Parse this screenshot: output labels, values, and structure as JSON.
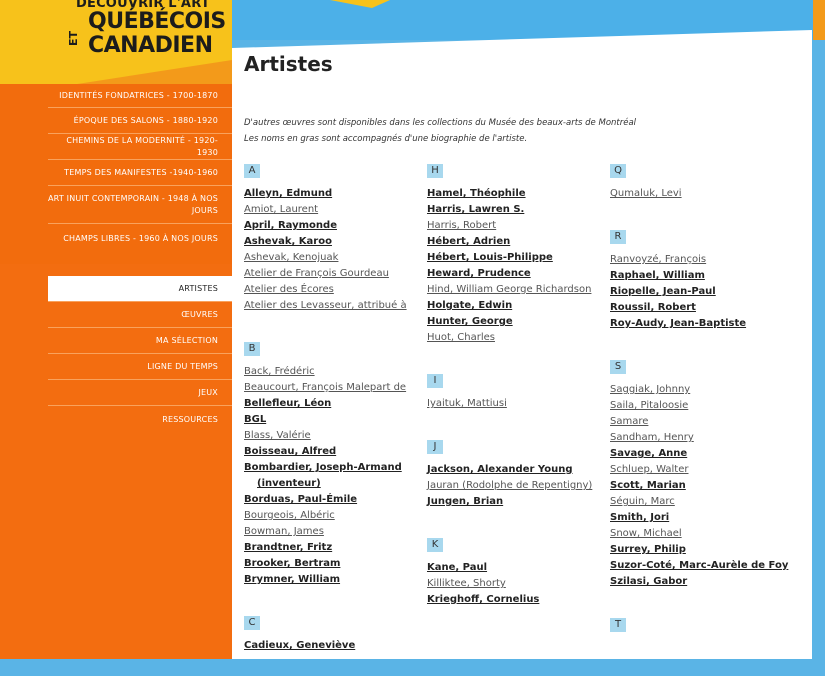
{
  "logo": {
    "line1": "DÉCOUVRIR L'ART",
    "line2": "QUÉBÉCOIS",
    "line3": "CANADIEN",
    "et": "ET"
  },
  "nav": {
    "main": [
      "IDENTITÉS FONDATRICES - 1700-1870",
      "ÉPOQUE DES SALONS - 1880-1920",
      "CHEMINS DE LA MODERNITÉ - 1920-1930",
      "TEMPS DES MANIFESTES -1940-1960",
      "ART INUIT CONTEMPORAIN - 1948 À NOS JOURS",
      "CHAMPS LIBRES - 1960 À NOS JOURS"
    ],
    "sub": [
      "ARTISTES",
      "ŒUVRES",
      "MA SÉLECTION",
      "LIGNE DU TEMPS",
      "JEUX",
      "RESSOURCES"
    ]
  },
  "page": {
    "title": "Artistes",
    "intro1": "D'autres œuvres sont disponibles dans les collections du Musée des beaux-arts de Montréal",
    "intro2": "Les noms en gras sont accompagnés d'une biographie de l'artiste."
  },
  "columns": [
    [
      {
        "letter": "A",
        "names": [
          {
            "t": "Alleyn, Edmund",
            "b": true
          },
          {
            "t": "Amiot, Laurent",
            "b": false
          },
          {
            "t": "April, Raymonde",
            "b": true
          },
          {
            "t": "Ashevak, Karoo",
            "b": true
          },
          {
            "t": "Ashevak, Kenojuak",
            "b": false
          },
          {
            "t": "Atelier de François Gourdeau",
            "b": false
          },
          {
            "t": "Atelier des Écores",
            "b": false
          },
          {
            "t": "Atelier des Levasseur, attribué à",
            "b": false
          }
        ]
      },
      {
        "letter": "B",
        "names": [
          {
            "t": "Back, Frédéric",
            "b": false
          },
          {
            "t": "Beaucourt, François Malepart de",
            "b": false
          },
          {
            "t": "Bellefleur, Léon",
            "b": true
          },
          {
            "t": "BGL",
            "b": true
          },
          {
            "t": "Blass, Valérie",
            "b": false
          },
          {
            "t": "Boisseau, Alfred",
            "b": true
          },
          {
            "t": "Bombardier, Joseph-Armand",
            "b": true
          },
          {
            "t": "(inventeur)",
            "b": true,
            "indent": true
          },
          {
            "t": "Borduas, Paul-Émile",
            "b": true
          },
          {
            "t": "Bourgeois, Albéric",
            "b": false
          },
          {
            "t": "Bowman, James",
            "b": false
          },
          {
            "t": "Brandtner, Fritz",
            "b": true
          },
          {
            "t": "Brooker, Bertram",
            "b": true
          },
          {
            "t": "Brymner, William",
            "b": true
          }
        ]
      },
      {
        "letter": "C",
        "names": [
          {
            "t": "Cadieux, Geneviève",
            "b": true
          }
        ]
      }
    ],
    [
      {
        "letter": "H",
        "names": [
          {
            "t": "Hamel, Théophile",
            "b": true
          },
          {
            "t": "Harris, Lawren S.",
            "b": true
          },
          {
            "t": "Harris, Robert",
            "b": false
          },
          {
            "t": "Hébert, Adrien",
            "b": true
          },
          {
            "t": "Hébert, Louis-Philippe",
            "b": true
          },
          {
            "t": "Heward, Prudence",
            "b": true
          },
          {
            "t": "Hind, William George Richardson",
            "b": false
          },
          {
            "t": "Holgate, Edwin",
            "b": true
          },
          {
            "t": "Hunter, George",
            "b": true
          },
          {
            "t": "Huot, Charles",
            "b": false
          }
        ]
      },
      {
        "letter": "I",
        "names": [
          {
            "t": "Iyaituk, Mattiusi",
            "b": false
          }
        ]
      },
      {
        "letter": "J",
        "names": [
          {
            "t": "Jackson, Alexander Young",
            "b": true
          },
          {
            "t": "Jauran (Rodolphe de Repentigny)",
            "b": false
          },
          {
            "t": "Jungen, Brian",
            "b": true
          }
        ]
      },
      {
        "letter": "K",
        "names": [
          {
            "t": "Kane, Paul",
            "b": true
          },
          {
            "t": "Killiktee, Shorty",
            "b": false
          },
          {
            "t": "Krieghoff, Cornelius",
            "b": true
          }
        ]
      }
    ],
    [
      {
        "letter": "Q",
        "names": [
          {
            "t": "Qumaluk, Levi",
            "b": false
          }
        ]
      },
      {
        "letter": "R",
        "names": [
          {
            "t": "Ranvoyzé, François",
            "b": false
          },
          {
            "t": "Raphael, William",
            "b": true
          },
          {
            "t": "Riopelle, Jean-Paul",
            "b": true
          },
          {
            "t": "Roussil, Robert",
            "b": true
          },
          {
            "t": "Roy-Audy, Jean-Baptiste",
            "b": true
          }
        ]
      },
      {
        "letter": "S",
        "names": [
          {
            "t": "Saggiak, Johnny",
            "b": false
          },
          {
            "t": "Saila, Pitaloosie",
            "b": false
          },
          {
            "t": "Samare",
            "b": false
          },
          {
            "t": "Sandham, Henry",
            "b": false
          },
          {
            "t": "Savage, Anne",
            "b": true
          },
          {
            "t": "Schluep, Walter",
            "b": false
          },
          {
            "t": "Scott, Marian",
            "b": true
          },
          {
            "t": "Séguin, Marc",
            "b": false
          },
          {
            "t": "Smith, Jori",
            "b": true
          },
          {
            "t": "Snow, Michael",
            "b": false
          },
          {
            "t": "Surrey, Philip",
            "b": true
          },
          {
            "t": "Suzor-Coté, Marc-Aurèle de Foy",
            "b": true
          },
          {
            "t": "Szilasi, Gabor",
            "b": true
          }
        ]
      },
      {
        "letter": "T",
        "names": []
      }
    ]
  ]
}
